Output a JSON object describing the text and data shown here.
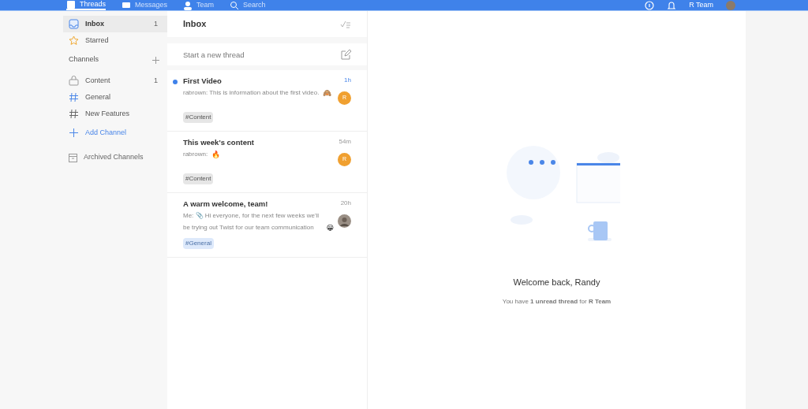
{
  "topbar": {
    "tabs": [
      {
        "label": "Threads",
        "selected": true
      },
      {
        "label": "Messages",
        "selected": false
      },
      {
        "label": "Team",
        "selected": false
      },
      {
        "label": "Search",
        "selected": false
      }
    ],
    "team_name": "R Team"
  },
  "sidebar": {
    "items": [
      {
        "label": "Inbox",
        "count": "1",
        "selected": true
      },
      {
        "label": "Starred",
        "selected": false
      }
    ],
    "channels_heading": "Channels",
    "channels": [
      {
        "label": "Content",
        "count": "1",
        "kind": "channel"
      },
      {
        "label": "General",
        "kind": "channel"
      },
      {
        "label": "New Features",
        "kind": "channel"
      },
      {
        "label": "Add Channel",
        "kind": "action"
      }
    ],
    "archived": "Archived Channels"
  },
  "thread_list": {
    "title": "Inbox",
    "new_thread_placeholder": "Start a new thread",
    "threads": [
      {
        "title": "First Video",
        "unread": true,
        "time": "1h",
        "preview": "rabrown: This is information about the first video.",
        "emoji": "🙈",
        "avatar": {
          "kind": "letter",
          "text": "R"
        },
        "tag": {
          "label": "#Content",
          "kind": "gray"
        }
      },
      {
        "title": "This week's content",
        "unread": false,
        "time": "54m",
        "preview": "rabrown:",
        "emoji": "🔥",
        "avatar": {
          "kind": "letter",
          "text": "R"
        },
        "tag": {
          "label": "#Content",
          "kind": "gray"
        }
      },
      {
        "title": "A warm welcome, team!",
        "unread": false,
        "time": "20h",
        "preview": "Me: 📎 Hi everyone, for the next few weeks we'll be trying out Twist for our team communication",
        "emoji": "😀",
        "avatar": {
          "kind": "photo"
        },
        "tag": {
          "label": "#General",
          "kind": "blue"
        }
      }
    ]
  },
  "main": {
    "heading": "Welcome back, Randy",
    "subtext": "You have **1 unread thread** for **R Team**"
  }
}
